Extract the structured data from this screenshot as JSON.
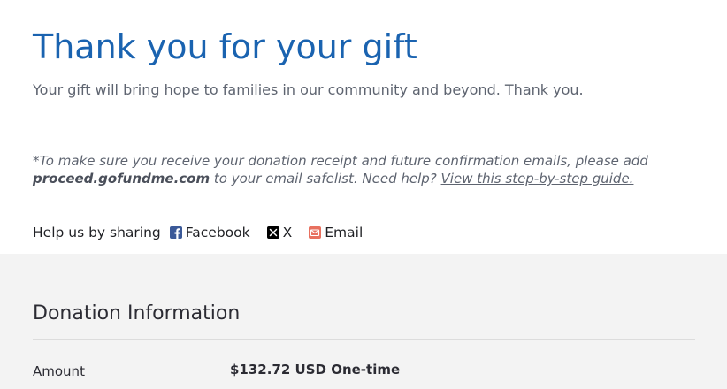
{
  "header": {
    "title": "Thank you for your gift",
    "subtitle": "Your gift will bring hope to families in our community and beyond. Thank you."
  },
  "note": {
    "part1": "*To make sure you receive your donation receipt and future confirmation emails, please add ",
    "domain": "proceed.gofundme.com",
    "part2": " to your email safelist. Need help? ",
    "link_text": "View this step-by-step guide."
  },
  "share": {
    "label": "Help us by sharing",
    "facebook": {
      "label": "Facebook",
      "icon": "facebook-icon",
      "color": "#3b5998"
    },
    "x": {
      "label": "X",
      "icon": "x-icon",
      "color": "#000000"
    },
    "email": {
      "label": "Email",
      "icon": "email-icon",
      "color": "#e8705f"
    }
  },
  "donation": {
    "section_title": "Donation Information",
    "amount_label": "Amount",
    "amount_value": "$132.72 USD One-time"
  },
  "colors": {
    "title": "#1a63b0",
    "muted_text": "#5e6470",
    "panel_bg": "#f3f3f3"
  }
}
